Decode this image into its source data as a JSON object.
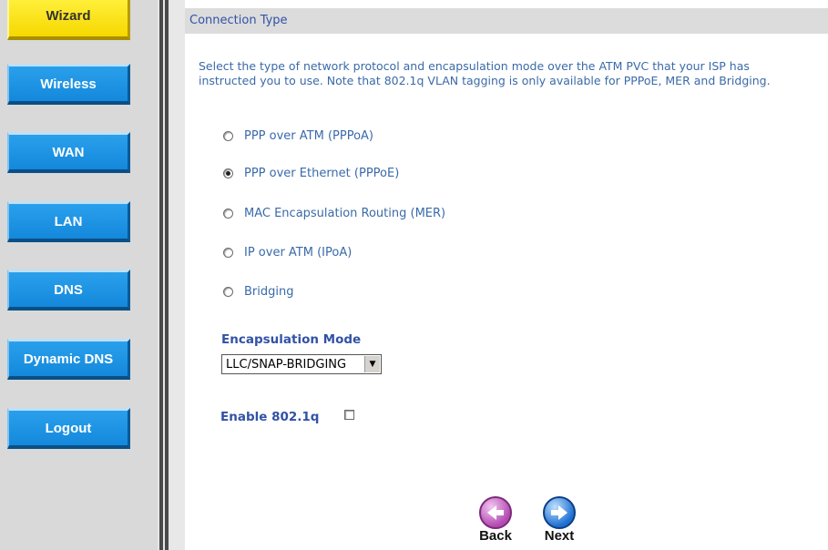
{
  "sidebar": {
    "items": [
      {
        "label": "Wizard"
      },
      {
        "label": "Wireless"
      },
      {
        "label": "WAN"
      },
      {
        "label": "LAN"
      },
      {
        "label": "DNS"
      },
      {
        "label": "Dynamic DNS"
      },
      {
        "label": "Logout"
      }
    ]
  },
  "main": {
    "title": "Connection Type",
    "intro_line1": "Select the type of network protocol and encapsulation mode over the ATM PVC that your ISP has",
    "intro_line2": "instructed you to use. Note that 802.1q VLAN tagging is only available for PPPoE, MER and Bridging.",
    "options": [
      {
        "label": "PPP over ATM (PPPoA)",
        "selected": false
      },
      {
        "label": "PPP over Ethernet (PPPoE)",
        "selected": true
      },
      {
        "label": "MAC Encapsulation Routing (MER)",
        "selected": false
      },
      {
        "label": "IP over ATM (IPoA)",
        "selected": false
      },
      {
        "label": "Bridging",
        "selected": false
      }
    ],
    "encapsulation": {
      "label": "Encapsulation Mode",
      "value": "LLC/SNAP-BRIDGING"
    },
    "vlan": {
      "label": "Enable 802.1q",
      "checked": false
    },
    "back_label": "Back",
    "next_label": "Next"
  },
  "colors": {
    "accent": "#3252a5",
    "nav_blue": "#1488db",
    "wizard_yellow": "#f6d800"
  }
}
